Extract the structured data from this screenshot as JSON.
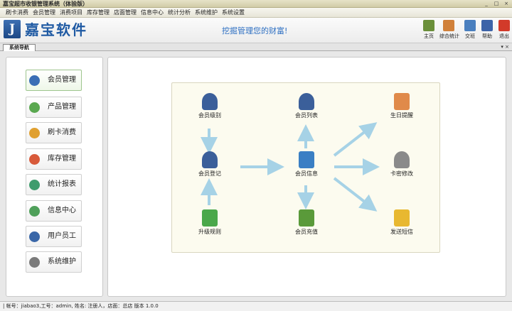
{
  "window": {
    "title": "嘉宝超市收银管理系统（体验版）",
    "controls": [
      "_",
      "□",
      "×"
    ]
  },
  "menu": [
    "刷卡消费",
    "会员管理",
    "消费项目",
    "库存管理",
    "店面管理",
    "信息中心",
    "统计分析",
    "系统维护",
    "系统设置"
  ],
  "header": {
    "logo_glyph": "J",
    "logo_text": "嘉宝软件",
    "slogan": "挖掘管理您的财富!"
  },
  "toolbar": [
    {
      "label": "主页",
      "icon": "home-icon",
      "color": "#6a8f3a"
    },
    {
      "label": "综合统计",
      "icon": "chart-icon",
      "color": "#d0803a"
    },
    {
      "label": "交班",
      "icon": "swap-icon",
      "color": "#4a7fbf"
    },
    {
      "label": "帮助",
      "icon": "help-icon",
      "color": "#3c63a8"
    },
    {
      "label": "退出",
      "icon": "power-icon",
      "color": "#d23a2a"
    }
  ],
  "tab": {
    "label": "系统导航",
    "controls": "▾ ×"
  },
  "nav": [
    {
      "label": "会员管理",
      "icon": "member-icon",
      "color": "#3a6db5"
    },
    {
      "label": "产品管理",
      "icon": "product-icon",
      "color": "#5aa850"
    },
    {
      "label": "刷卡消费",
      "icon": "card-icon",
      "color": "#e0a030"
    },
    {
      "label": "库存管理",
      "icon": "stock-icon",
      "color": "#d85a3a"
    },
    {
      "label": "统计报表",
      "icon": "report-icon",
      "color": "#3f9c6d"
    },
    {
      "label": "信息中心",
      "icon": "info-icon",
      "color": "#4fa05a"
    },
    {
      "label": "用户员工",
      "icon": "staff-icon",
      "color": "#3a67a8"
    },
    {
      "label": "系统维护",
      "icon": "settings-icon",
      "color": "#7a7a7a"
    }
  ],
  "diagram": {
    "nodes": [
      {
        "label": "会员级别",
        "icon": "member-level-icon",
        "color": "#3b5f9a"
      },
      {
        "label": "会员列表",
        "icon": "member-list-icon",
        "color": "#3b5f9a"
      },
      {
        "label": "生日提醒",
        "icon": "birthday-cake-icon",
        "color": "#e08a4a"
      },
      {
        "label": "会员登记",
        "icon": "member-register-icon",
        "color": "#3b5f9a"
      },
      {
        "label": "会员信息",
        "icon": "member-info-icon",
        "color": "#3a7fc4"
      },
      {
        "label": "卡密修改",
        "icon": "card-password-icon",
        "color": "#8a8a8a"
      },
      {
        "label": "升级规则",
        "icon": "upgrade-rule-icon",
        "color": "#4aa84a"
      },
      {
        "label": "会员充值",
        "icon": "member-recharge-icon",
        "color": "#5a9a3a"
      },
      {
        "label": "发送短信",
        "icon": "send-sms-icon",
        "color": "#e8b830"
      }
    ],
    "arrow_color": "#a6d2e6"
  },
  "status": {
    "text": "| 帐号：jiabao3,工号：admin, 姓名: 注册人，店面：总店    版本 1.0.0"
  }
}
